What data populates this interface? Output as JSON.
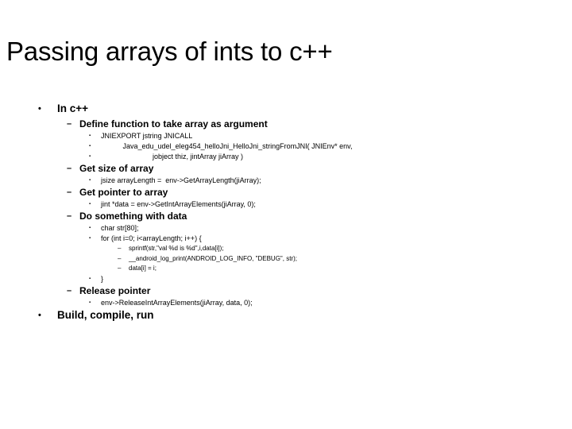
{
  "slide": {
    "title": "Passing arrays of ints to c++",
    "outline": [
      {
        "level": 1,
        "bullet": "•",
        "text": "In c++"
      },
      {
        "level": 2,
        "bullet": "–",
        "text": "Define function to take array as argument"
      },
      {
        "level": 3,
        "bullet": "▪",
        "text": "JNIEXPORT jstring JNICALL"
      },
      {
        "level": 3,
        "bullet": "▪",
        "text": "           Java_edu_udel_eleg454_helloJni_HelloJni_stringFromJNI( JNIEnv* env,"
      },
      {
        "level": 3,
        "bullet": "▪",
        "text": "                          jobject thiz, jintArray jiArray )"
      },
      {
        "level": 2,
        "bullet": "–",
        "text": "Get size of array"
      },
      {
        "level": 3,
        "bullet": "▪",
        "text": "jsize arrayLength =  env->GetArrayLength(jiArray);"
      },
      {
        "level": 2,
        "bullet": "–",
        "text": "Get pointer to array"
      },
      {
        "level": 3,
        "bullet": "▪",
        "text": "jint *data = env->GetIntArrayElements(jiArray, 0);"
      },
      {
        "level": 2,
        "bullet": "–",
        "text": "Do something with data"
      },
      {
        "level": 3,
        "bullet": "▪",
        "text": "char str[80];"
      },
      {
        "level": 3,
        "bullet": "▪",
        "text": "for (int i=0; i<arrayLength; i++) {"
      },
      {
        "level": 4,
        "bullet": "–",
        "text": "sprintf(str,\"val %d is %d\",i,data[i]);"
      },
      {
        "level": 4,
        "bullet": "–",
        "text": "__android_log_print(ANDROID_LOG_INFO, \"DEBUG\", str);"
      },
      {
        "level": 4,
        "bullet": "–",
        "text": "data[i] = i;"
      },
      {
        "level": 3,
        "bullet": "▪",
        "text": "}"
      },
      {
        "level": 2,
        "bullet": "–",
        "text": "Release pointer"
      },
      {
        "level": 3,
        "bullet": "▪",
        "text": "env->ReleaseIntArrayElements(jiArray, data, 0);"
      },
      {
        "level": 1,
        "bullet": "•",
        "text": "Build, compile, run"
      }
    ]
  },
  "colors": {
    "background": "#ffffff",
    "text": "#000000"
  }
}
